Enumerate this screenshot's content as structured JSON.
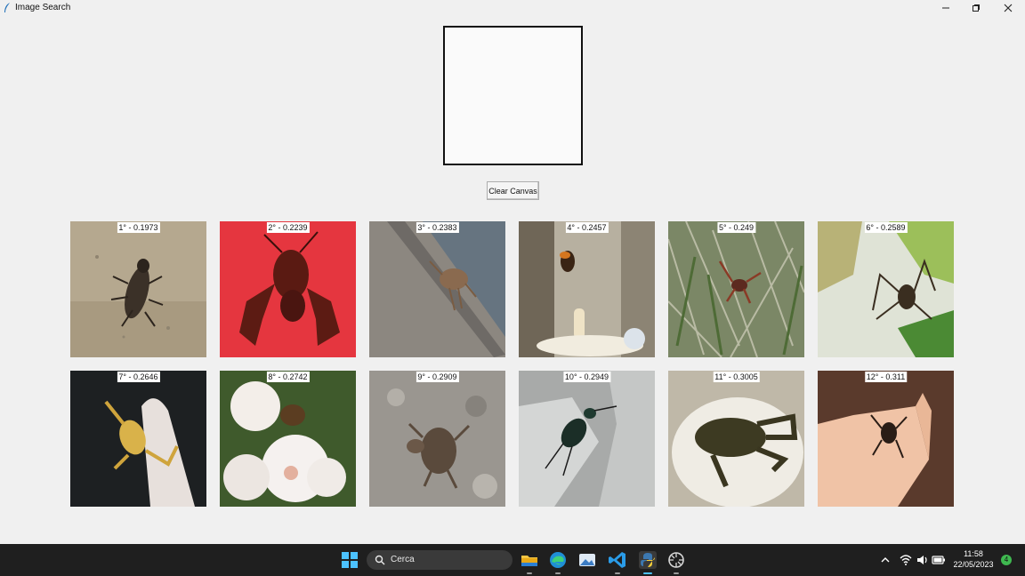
{
  "window": {
    "title": "Image Search",
    "icons": [
      "feather-icon",
      "minimize-icon",
      "restore-icon",
      "close-icon"
    ]
  },
  "canvas": {
    "clear_label": "Clear Canvas"
  },
  "results": [
    {
      "caption": "1° - 0.1973",
      "subject": "tiger beetle on sand"
    },
    {
      "caption": "2° - 0.2239",
      "subject": "crayfish on red background"
    },
    {
      "caption": "3° - 0.2383",
      "subject": "crab on wooden plank"
    },
    {
      "caption": "4° - 0.2457",
      "subject": "insect flying over candle"
    },
    {
      "caption": "5° - 0.249",
      "subject": "crab in grass"
    },
    {
      "caption": "6° - 0.2589",
      "subject": "spider on leaf"
    },
    {
      "caption": "7° - 0.2646",
      "subject": "scorpion on hand"
    },
    {
      "caption": "8° - 0.2742",
      "subject": "insect on white flower"
    },
    {
      "caption": "9° - 0.2909",
      "subject": "crab on rock"
    },
    {
      "caption": "10° - 0.2949",
      "subject": "ground beetle on snow"
    },
    {
      "caption": "11° - 0.3005",
      "subject": "lobster on plate"
    },
    {
      "caption": "12° - 0.311",
      "subject": "spider on hand"
    }
  ],
  "taskbar": {
    "search_label": "Cerca",
    "apps": [
      "windows-start-icon",
      "file-explorer-icon",
      "edge-icon",
      "photos-icon",
      "vscode-icon",
      "python-icon",
      "settings-icon"
    ],
    "time": "11:58",
    "date": "22/05/2023",
    "notification_count": "4",
    "tray_icons": [
      "chevron-up-icon",
      "wifi-icon",
      "speaker-icon",
      "battery-icon"
    ]
  }
}
